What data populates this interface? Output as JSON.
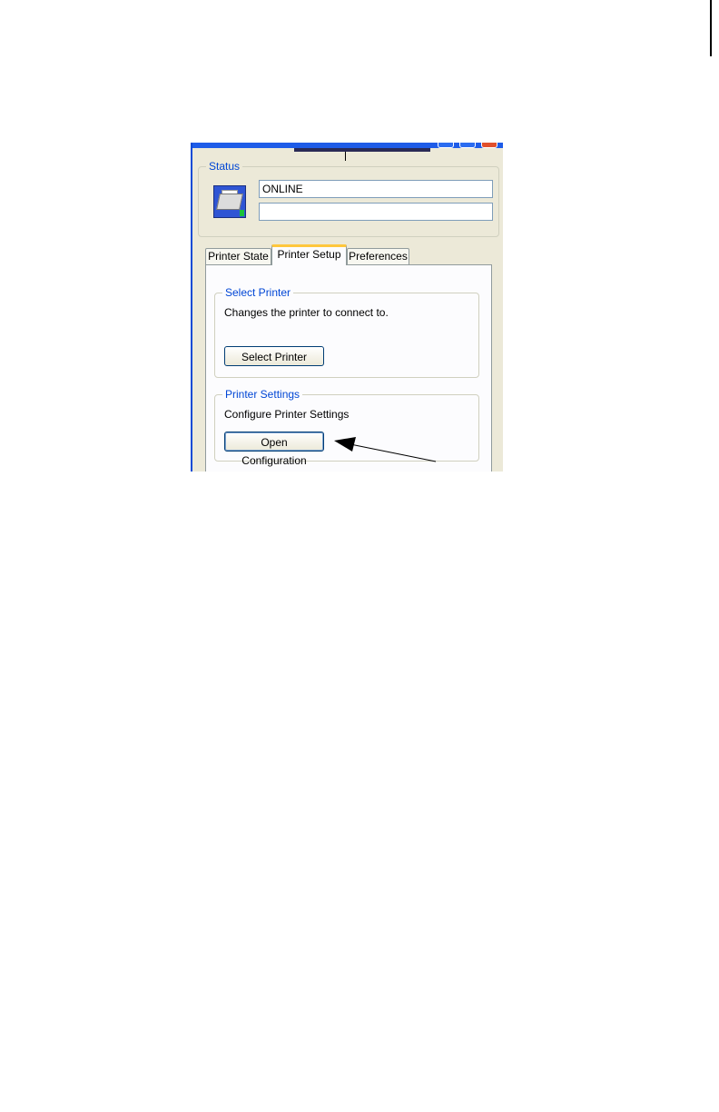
{
  "window": {
    "status_group_title": "Status",
    "status_line1": "ONLINE",
    "status_line2": "",
    "tabs": [
      {
        "label": "Printer State",
        "active": false
      },
      {
        "label": "Printer Setup",
        "active": true
      },
      {
        "label": "Preferences",
        "active": false
      }
    ],
    "select_printer": {
      "title": "Select Printer",
      "description": "Changes the printer to connect to.",
      "button_label": "Select Printer"
    },
    "printer_settings": {
      "title": "Printer Settings",
      "description": "Configure Printer Settings",
      "button_label": "Open Configuration"
    }
  },
  "icons": [
    "printer-icon",
    "annotation-arrow-icon"
  ],
  "colors": {
    "group_title": "#0046d5",
    "active_tab_accent": "#ffc73c",
    "titlebar": "#1e5ce8",
    "window_bg": "#ece9d8"
  }
}
